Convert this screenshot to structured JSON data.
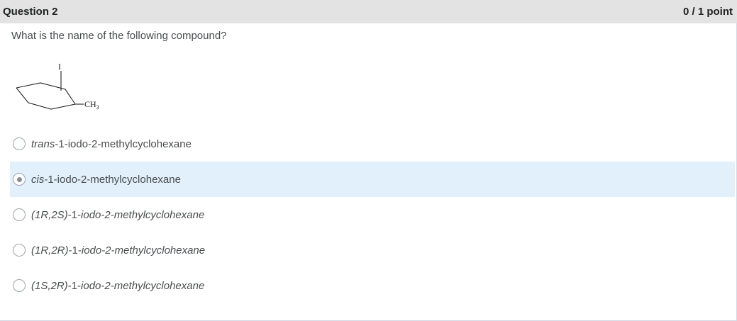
{
  "question": {
    "title": "Question 2",
    "score": "0 / 1 point",
    "prompt": "What is the name of the following compound?"
  },
  "structure": {
    "iodine_label": "I",
    "methyl_label": "CH",
    "methyl_subscript": "3"
  },
  "choices": [
    {
      "prefix": "trans",
      "name": "-1-iodo-2-methylcyclohexane",
      "selected": false
    },
    {
      "prefix": "cis",
      "name": "-1-iodo-2-methylcyclohexane",
      "selected": true
    },
    {
      "prefix": "(1R,2S)",
      "mid": "-1-",
      "name": "iodo-2-methylcyclohexane",
      "selected": false
    },
    {
      "prefix": "(1R,2R)",
      "mid": "-1-",
      "name": "iodo-2-methylcyclohexane",
      "selected": false
    },
    {
      "prefix": "(1S,2R)",
      "mid": "-1-",
      "name": "iodo-2-methylcyclohexane",
      "selected": false
    }
  ]
}
